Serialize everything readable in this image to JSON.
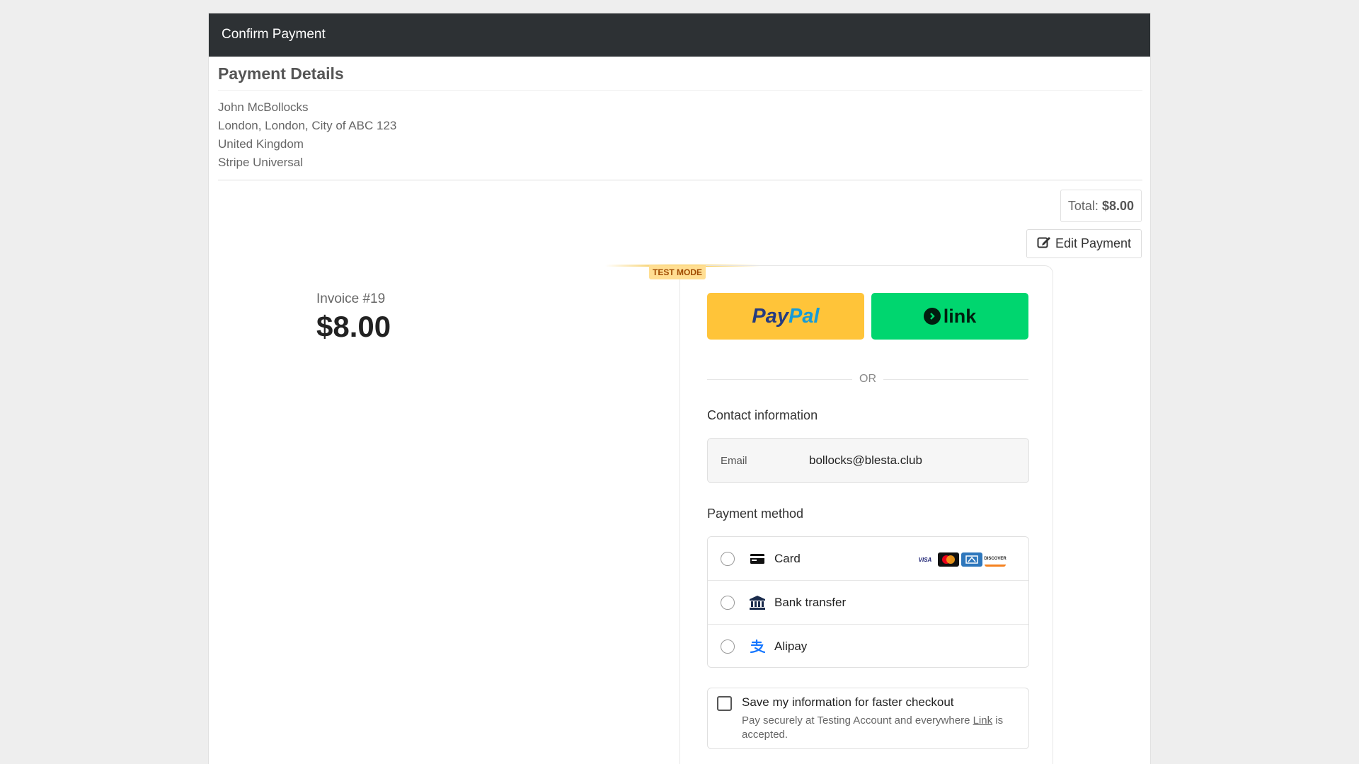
{
  "header": {
    "title": "Confirm Payment"
  },
  "details": {
    "title": "Payment Details",
    "address_lines": [
      "John McBollocks",
      "London, London, City of ABC 123",
      "United Kingdom",
      "Stripe Universal"
    ]
  },
  "total": {
    "label": "Total:",
    "value": "$8.00"
  },
  "edit_button": {
    "label": "Edit Payment",
    "icon": "edit-icon"
  },
  "checkout": {
    "test_mode": "TEST MODE",
    "invoice_label": "Invoice #19",
    "invoice_amount": "$8.00",
    "paypal": {
      "part1": "Pay",
      "part2": "Pal"
    },
    "link": {
      "label": "link"
    },
    "or_text": "OR",
    "contact_title": "Contact information",
    "email": {
      "label": "Email",
      "value": "bollocks@blesta.club"
    },
    "payment_method_title": "Payment method",
    "methods": [
      {
        "label": "Card",
        "icon": "card-icon"
      },
      {
        "label": "Bank transfer",
        "icon": "bank-icon"
      },
      {
        "label": "Alipay",
        "icon": "alipay-icon"
      }
    ],
    "card_brands": [
      "VISA",
      "mastercard",
      "AMEX",
      "DISCOVER"
    ],
    "save": {
      "title": "Save my information for faster checkout",
      "desc_pre": "Pay securely at Testing Account and everywhere ",
      "desc_link": "Link",
      "desc_post": " is accepted."
    }
  },
  "colors": {
    "header_bg": "#2d3134",
    "paypal_bg": "#ffc439",
    "link_bg": "#00d66f",
    "pay_button": "#0b74de",
    "test_badge": "#ffde92"
  }
}
